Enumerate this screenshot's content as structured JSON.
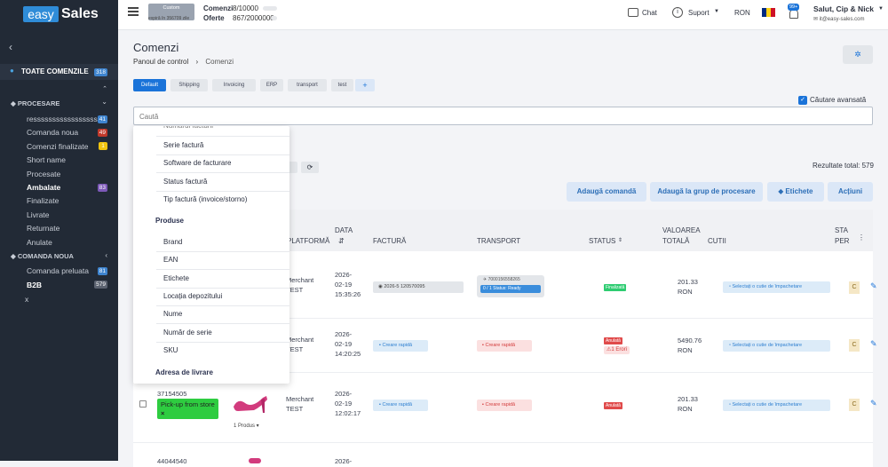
{
  "brand": {
    "left": "easy",
    "right": "Sales"
  },
  "plan": {
    "name": "Custom",
    "expiry": "expiră în 356709 zile"
  },
  "quota": {
    "orders_label": "Comenzi",
    "orders_value": "8/10000",
    "offers_label": "Oferte",
    "offers_value": "867/2000000"
  },
  "topnav": {
    "chat": "Chat",
    "support": "Suport",
    "currency": "RON",
    "notif_badge": "99+",
    "greeting": "Salut, Cip & Nick",
    "email": "it@easy-sales.com"
  },
  "sidebar": {
    "all_orders": "TOATE COMENZILE",
    "all_orders_badge": "318",
    "processing_head": "PROCESARE",
    "items": [
      {
        "label": "resssssssssssssssssss",
        "badge": "41",
        "badge_color": "#3e84cf"
      },
      {
        "label": "Comanda noua",
        "badge": "49",
        "badge_color": "#c0392b"
      },
      {
        "label": "Comenzi finalizate",
        "badge": "1",
        "badge_color": "#f1c40f"
      },
      {
        "label": "Short name",
        "badge": "",
        "badge_color": ""
      },
      {
        "label": "Procesate",
        "badge": "",
        "badge_color": ""
      },
      {
        "label": "Ambalate",
        "badge": "83",
        "badge_color": "#7d59b8"
      },
      {
        "label": "Finalizate",
        "badge": "",
        "badge_color": ""
      },
      {
        "label": "Livrate",
        "badge": "",
        "badge_color": ""
      },
      {
        "label": "Returnate",
        "badge": "",
        "badge_color": ""
      },
      {
        "label": "Anulate",
        "badge": "",
        "badge_color": ""
      }
    ],
    "new_head": "COMANDA NOUA",
    "new_items": [
      {
        "label": "Comanda preluata",
        "badge": "81",
        "badge_color": "#3e84cf"
      },
      {
        "label": "B2B",
        "badge": "579",
        "badge_color": "#5b6270"
      }
    ],
    "x_label": "x"
  },
  "page": {
    "title": "Comenzi",
    "crumb_home": "Panoul de control",
    "crumb_current": "Comenzi"
  },
  "tabs": [
    "Default",
    "Shipping",
    "Invoicing",
    "ERP",
    "transport",
    "test"
  ],
  "tab_add": "+",
  "search": {
    "placeholder": "Caută",
    "advanced_label": "Căutare avansată"
  },
  "results": "Rezultate total: 579",
  "actions": {
    "add_order": "Adaugă comandă",
    "add_to_group": "Adaugă la grup de procesare",
    "labels": "Etichete",
    "actions": "Acțiuni"
  },
  "dropdown": {
    "first": "Numărul facturii",
    "invoice_items": [
      "Serie factură",
      "Software de facturare",
      "Status factură",
      "Tip factură (invoice/storno)"
    ],
    "products_head": "Produse",
    "product_items": [
      "Brand",
      "EAN",
      "Etichete",
      "Locația depozitului",
      "Nume",
      "Număr de serie",
      "SKU"
    ],
    "address_head": "Adresa de livrare"
  },
  "table": {
    "headers": {
      "platform": "PLATFORMĂ",
      "date": "DATA",
      "invoice": "FACTURĂ",
      "transport": "TRANSPORT",
      "status": "STATUS",
      "value_l1": "VALOAREA",
      "value_l2": "TOTALĂ",
      "boxes": "CUTII",
      "extra_l1": "STA",
      "extra_l2": "PER"
    },
    "rows": [
      {
        "platform_l1": "Merchant",
        "platform_l2": "TEST",
        "date_l1": "2026-",
        "date_l2": "02-19",
        "date_l3": "15:35:26",
        "invoice": "2026-5 120570095",
        "transport_awb": "7000156558265",
        "transport_status": "Status: Ready",
        "transport_count": "0 / 1",
        "status": "Finalizată",
        "value_l1": "201.33",
        "value_l2": "RON",
        "box": "Selectați o cutie de împachetare",
        "extra": "C"
      },
      {
        "platform_l1": "Merchant",
        "platform_l2": "TEST",
        "date_l1": "2026-",
        "date_l2": "02-19",
        "date_l3": "14:20:25",
        "invoice": "Creare rapidă",
        "transport": "Creare rapidă",
        "status": "Anulată",
        "errors": "1 Erori",
        "value_l1": "5490.76",
        "value_l2": "RON",
        "box": "Selectați o cutie de împachetare",
        "extra": "C"
      },
      {
        "order_id": "37154505",
        "pickup": "Pick-up from store",
        "products": "1 Produs",
        "platform_l1": "Merchant",
        "platform_l2": "TEST",
        "date_l1": "2026-",
        "date_l2": "02-19",
        "date_l3": "12:02:17",
        "invoice": "Creare rapidă",
        "transport": "Creare rapidă",
        "status": "Anulată",
        "value_l1": "201.33",
        "value_l2": "RON",
        "box": "Selectați o cutie de împachetare",
        "extra": "C"
      },
      {
        "order_id": "44044540",
        "date_l1": "2026-"
      }
    ]
  },
  "colors": {
    "accent": "#1a73d9",
    "sidebar_bg": "#222a36",
    "green": "#2ecc71",
    "red": "#e04a4a"
  }
}
